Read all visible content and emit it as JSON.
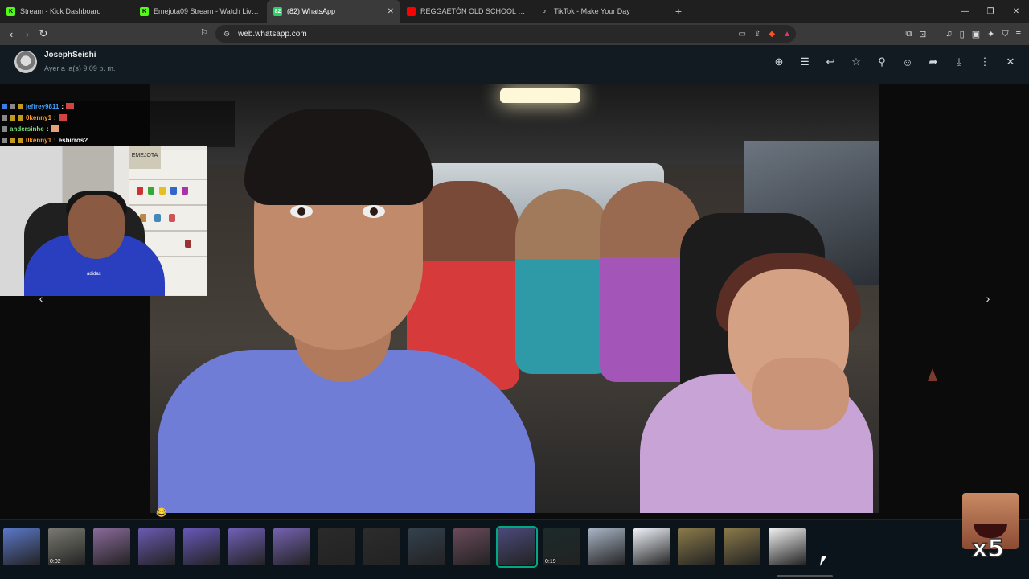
{
  "browser": {
    "tabs": [
      {
        "title": "Stream - Kick Dashboard",
        "icon": "kick-icon",
        "fav_text": "K",
        "fav_color": "#53fc18",
        "active": false
      },
      {
        "title": "Emejota09 Stream - Watch Live o",
        "icon": "kick-icon",
        "fav_text": "K",
        "fav_color": "#53fc18",
        "active": false
      },
      {
        "title": "(82) WhatsApp",
        "icon": "whatsapp-icon",
        "fav_text": "82",
        "fav_color": "#25d366",
        "active": true
      },
      {
        "title": "REGGAETÓN OLD SCHOOL 🔥 ENGA",
        "icon": "youtube-icon",
        "fav_text": "",
        "fav_color": "#ff0000",
        "active": false
      },
      {
        "title": "TikTok - Make Your Day",
        "icon": "tiktok-icon",
        "fav_text": "♪",
        "fav_color": "#1f1f1f",
        "active": false
      }
    ],
    "new_tab": "+",
    "url": "web.whatsapp.com"
  },
  "viewer": {
    "sender_name": "JosephSeishi",
    "timestamp": "Ayer a la(s) 9:09 p. m.",
    "tools": [
      "zoom-in-icon",
      "caption-icon",
      "reply-icon",
      "star-icon",
      "pin-icon",
      "emoji-icon",
      "forward-icon",
      "download-icon",
      "more-icon",
      "close-icon"
    ]
  },
  "stream_chat": [
    {
      "user": "jeffrey9811",
      "sep": ":",
      "msg": "",
      "color": "#4aa3ff"
    },
    {
      "user": "0kenny1",
      "sep": ":",
      "msg": "",
      "color": "#ff9d2e"
    },
    {
      "user": "andersinhe",
      "sep": ":",
      "msg": "",
      "color": "#7de07a"
    },
    {
      "user": "0kenny1",
      "sep": ":",
      "msg": "esbirros?",
      "color": "#ff9d2e"
    }
  ],
  "webcam": {
    "shirt_text": "adidas",
    "sign_text": "EMEJOTA"
  },
  "thumbnails": [
    {
      "duration": "",
      "color": "#5b78c8"
    },
    {
      "duration": "0:02",
      "color": "#7a7a72"
    },
    {
      "duration": "",
      "color": "#8a6a9a"
    },
    {
      "duration": "",
      "color": "#6a5ab0"
    },
    {
      "duration": "",
      "color": "#6858b8"
    },
    {
      "duration": "",
      "color": "#7060b6"
    },
    {
      "duration": "",
      "color": "#7462b0"
    },
    {
      "duration": "",
      "color": "#2a2a2a"
    },
    {
      "duration": "",
      "color": "#2c2c2c"
    },
    {
      "duration": "",
      "color": "#33414e"
    },
    {
      "duration": "",
      "color": "#6a4a5a"
    },
    {
      "duration": "",
      "color": "#4a4a7a"
    },
    {
      "duration": "0:19",
      "color": "#1c2a2a"
    },
    {
      "duration": "",
      "color": "#a8b4c4"
    },
    {
      "duration": "",
      "color": "#eef2f8"
    },
    {
      "duration": "",
      "color": "#8a7a4a"
    },
    {
      "duration": "",
      "color": "#8a7a4a"
    },
    {
      "duration": "",
      "color": "#f0f0f0"
    }
  ],
  "selected_thumbnail_index": 11,
  "sticker_text": "x5",
  "reaction_emoji": "😂"
}
